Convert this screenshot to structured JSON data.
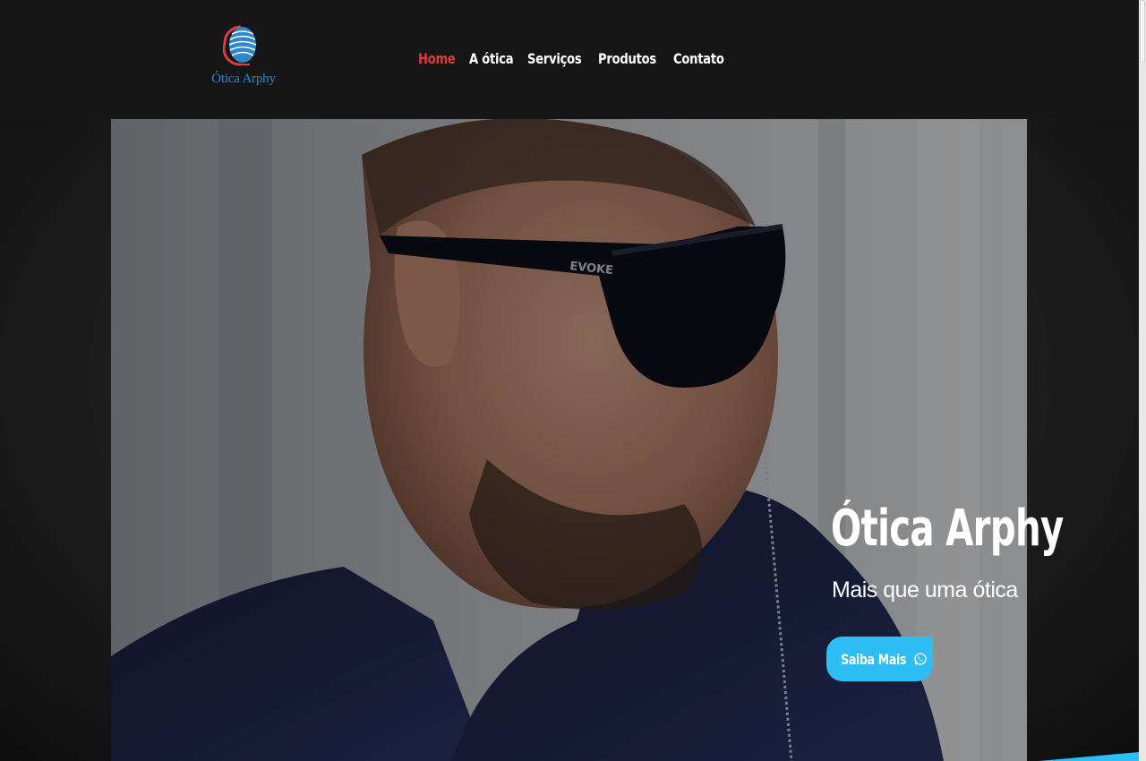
{
  "brand": {
    "name": "Ótica Arphy",
    "colors": {
      "accent_red": "#e23b3b",
      "accent_blue": "#2ebdf5",
      "logo_blue": "#2f86c9"
    },
    "logo_icon": "striped-globe-logo"
  },
  "nav": {
    "items": [
      {
        "label": "Home",
        "active": true
      },
      {
        "label": "A ótica",
        "active": false
      },
      {
        "label": "Serviços",
        "active": false
      },
      {
        "label": "Produtos",
        "active": false
      },
      {
        "label": "Contato",
        "active": false
      }
    ]
  },
  "hero": {
    "title": "Ótica Arphy",
    "subtitle": "Mais que uma ótica",
    "cta_label": "Saiba Mais",
    "cta_icon": "whatsapp-icon",
    "glasses_brand": "EVOKE"
  }
}
